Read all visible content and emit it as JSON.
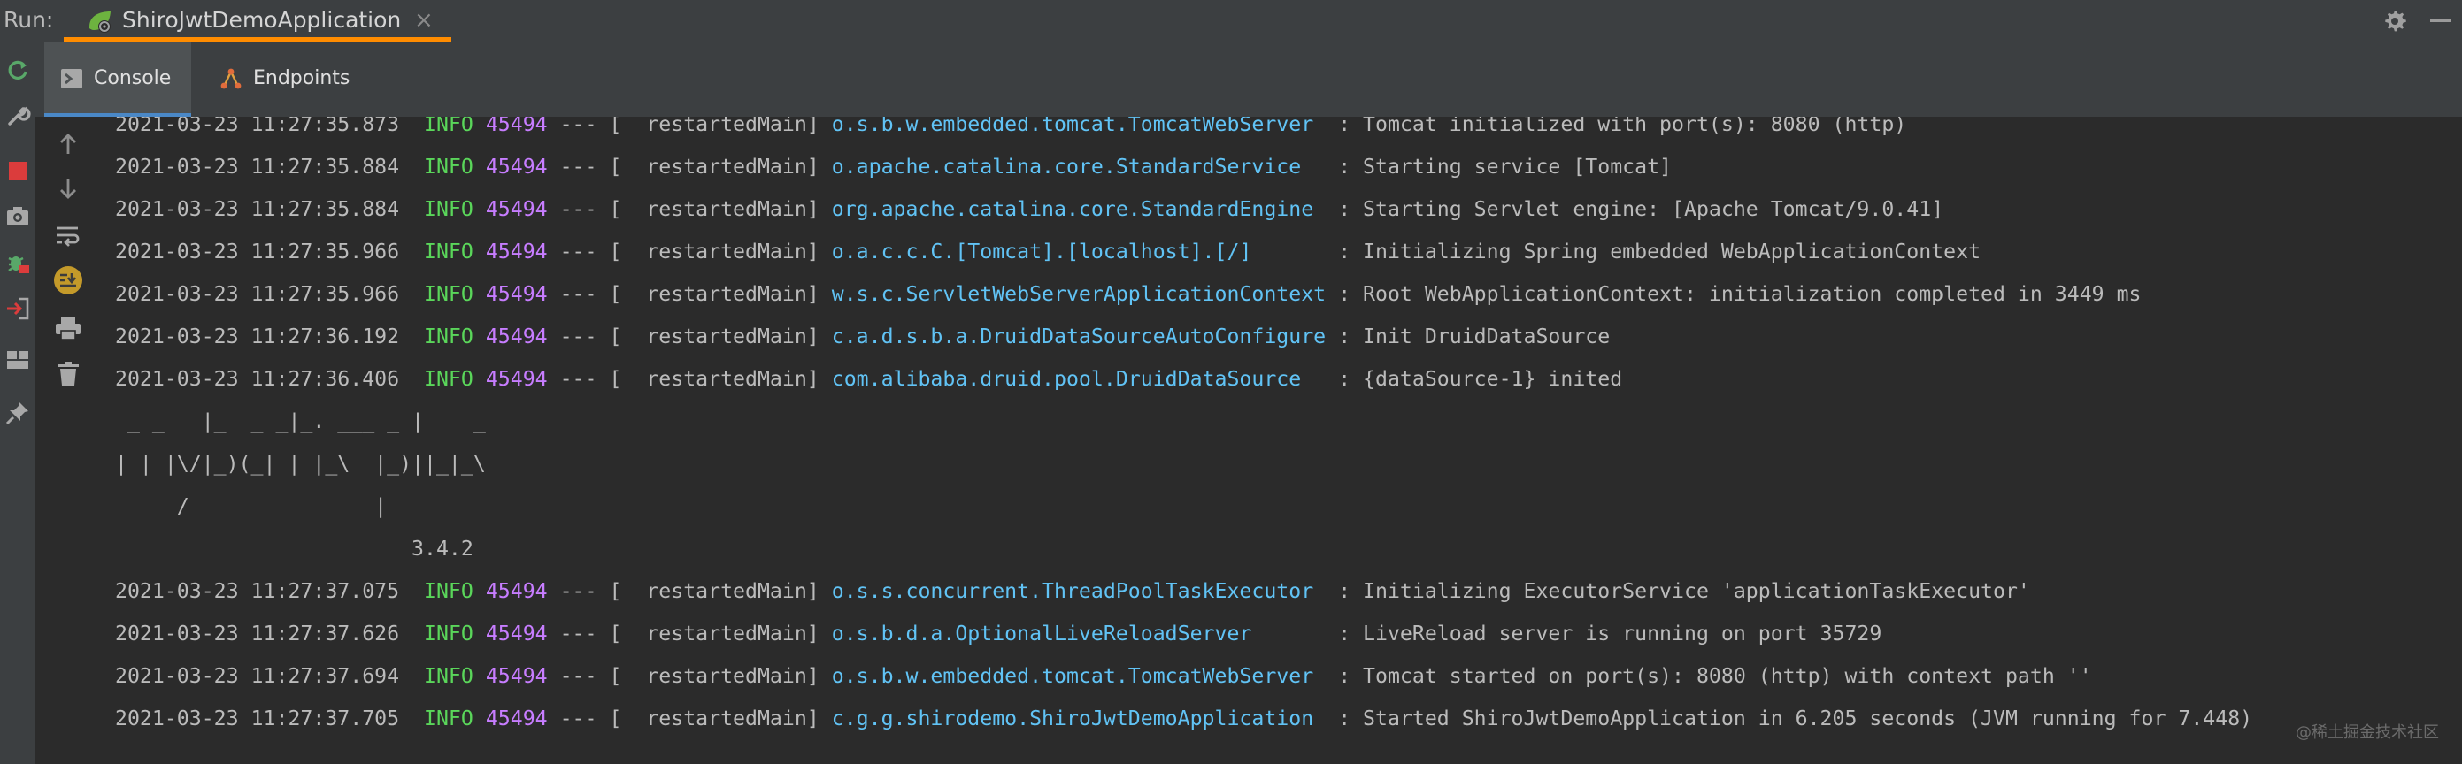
{
  "run_bar": {
    "label": "Run:",
    "tab_title": "ShiroJwtDemoApplication",
    "close_glyph": "×",
    "accent_color": "#ff8c00"
  },
  "tabs": [
    {
      "label": "Console",
      "icon": "console-icon",
      "active": true
    },
    {
      "label": "Endpoints",
      "icon": "endpoints-icon",
      "active": false
    }
  ],
  "outer_toolbar_icons": [
    "rerun-icon",
    "wrench-icon",
    "stop-icon",
    "camera-icon",
    "debug-bug-icon",
    "exit-icon",
    "layout-icon",
    "pin-icon"
  ],
  "inner_toolbar_icons": [
    "up-arrow-icon",
    "down-arrow-icon",
    "soft-wrap-icon",
    "scroll-to-end-icon",
    "print-icon",
    "trash-icon"
  ],
  "colors": {
    "info": "#5ad65a",
    "pid": "#c77dff",
    "logger": "#61c3f5",
    "text": "#bbbbbb",
    "background": "#2b2b2b"
  },
  "log_lines": [
    {
      "ts": "2021-03-23 11:27:35.873",
      "level": "INFO",
      "pid": "45494",
      "sep": "--- [  restartedMain]",
      "logger": "o.s.b.w.embedded.tomcat.TomcatWebServer ",
      "msg": " : Tomcat initialized with port(s): 8080 (http)"
    },
    {
      "ts": "2021-03-23 11:27:35.884",
      "level": "INFO",
      "pid": "45494",
      "sep": "--- [  restartedMain]",
      "logger": "o.apache.catalina.core.StandardService  ",
      "msg": " : Starting service [Tomcat]"
    },
    {
      "ts": "2021-03-23 11:27:35.884",
      "level": "INFO",
      "pid": "45494",
      "sep": "--- [  restartedMain]",
      "logger": "org.apache.catalina.core.StandardEngine ",
      "msg": " : Starting Servlet engine: [Apache Tomcat/9.0.41]"
    },
    {
      "ts": "2021-03-23 11:27:35.966",
      "level": "INFO",
      "pid": "45494",
      "sep": "--- [  restartedMain]",
      "logger": "o.a.c.c.C.[Tomcat].[localhost].[/]      ",
      "msg": " : Initializing Spring embedded WebApplicationContext"
    },
    {
      "ts": "2021-03-23 11:27:35.966",
      "level": "INFO",
      "pid": "45494",
      "sep": "--- [  restartedMain]",
      "logger": "w.s.c.ServletWebServerApplicationContext",
      "msg": " : Root WebApplicationContext: initialization completed in 3449 ms"
    },
    {
      "ts": "2021-03-23 11:27:36.192",
      "level": "INFO",
      "pid": "45494",
      "sep": "--- [  restartedMain]",
      "logger": "c.a.d.s.b.a.DruidDataSourceAutoConfigure",
      "msg": " : Init DruidDataSource"
    },
    {
      "ts": "2021-03-23 11:27:36.406",
      "level": "INFO",
      "pid": "45494",
      "sep": "--- [  restartedMain]",
      "logger": "com.alibaba.druid.pool.DruidDataSource  ",
      "msg": " : {dataSource-1} inited"
    }
  ],
  "banner_lines": [
    " _ _   |_  _ _|_. ___ _ |    _",
    "| | |\\/|_)(_| | |_\\  |_)||_|_\\",
    "     /               |",
    "                        3.4.2"
  ],
  "log_lines_after": [
    {
      "ts": "2021-03-23 11:27:37.075",
      "level": "INFO",
      "pid": "45494",
      "sep": "--- [  restartedMain]",
      "logger": "o.s.s.concurrent.ThreadPoolTaskExecutor ",
      "msg": " : Initializing ExecutorService 'applicationTaskExecutor'"
    },
    {
      "ts": "2021-03-23 11:27:37.626",
      "level": "INFO",
      "pid": "45494",
      "sep": "--- [  restartedMain]",
      "logger": "o.s.b.d.a.OptionalLiveReloadServer      ",
      "msg": " : LiveReload server is running on port 35729"
    },
    {
      "ts": "2021-03-23 11:27:37.694",
      "level": "INFO",
      "pid": "45494",
      "sep": "--- [  restartedMain]",
      "logger": "o.s.b.w.embedded.tomcat.TomcatWebServer ",
      "msg": " : Tomcat started on port(s): 8080 (http) with context path ''"
    },
    {
      "ts": "2021-03-23 11:27:37.705",
      "level": "INFO",
      "pid": "45494",
      "sep": "--- [  restartedMain]",
      "logger": "c.g.g.shirodemo.ShiroJwtDemoApplication ",
      "msg": " : Started ShiroJwtDemoApplication in 6.205 seconds (JVM running for 7.448)"
    }
  ],
  "watermark": "@稀土掘金技术社区"
}
